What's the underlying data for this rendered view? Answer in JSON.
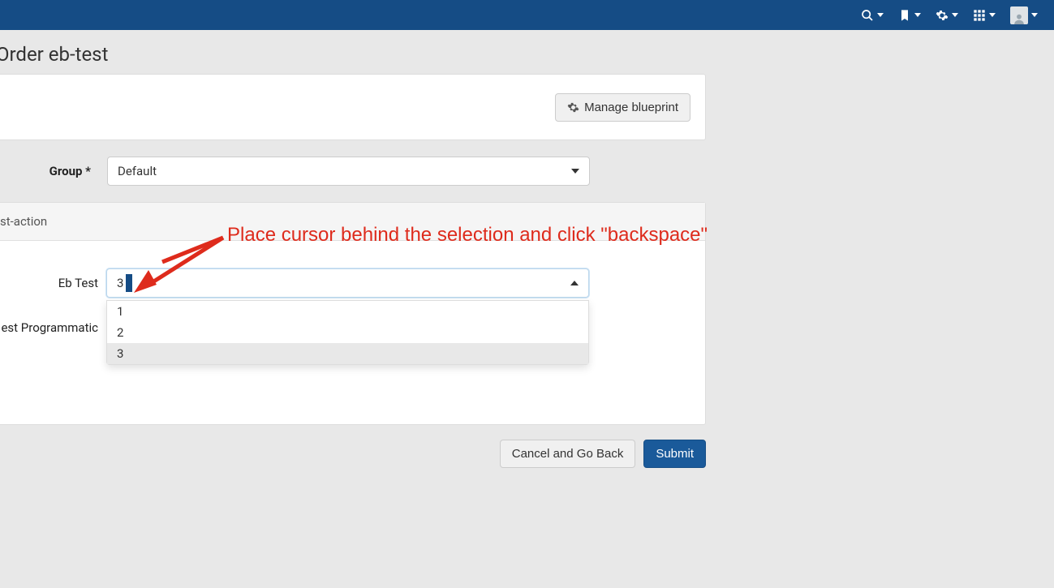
{
  "page": {
    "title": "Order eb-test"
  },
  "nav": {
    "gear_label": "settings",
    "grid_label": "apps",
    "search_label": "search",
    "bookmark_label": "bookmarks",
    "user_label": "user"
  },
  "card1": {
    "manage_blueprint_label": "Manage blueprint"
  },
  "group": {
    "label": "Group *",
    "value": "Default"
  },
  "card2": {
    "header": "st-action",
    "eb_test": {
      "label": "Eb Test",
      "selected": "3",
      "options": [
        "1",
        "2",
        "3"
      ],
      "highlighted_index": 2
    },
    "prog": {
      "label": "est Programmatic"
    }
  },
  "footer": {
    "cancel_label": "Cancel and Go Back",
    "submit_label": "Submit"
  },
  "annotation": {
    "text": "Place cursor behind the selection and click \"backspace\""
  }
}
